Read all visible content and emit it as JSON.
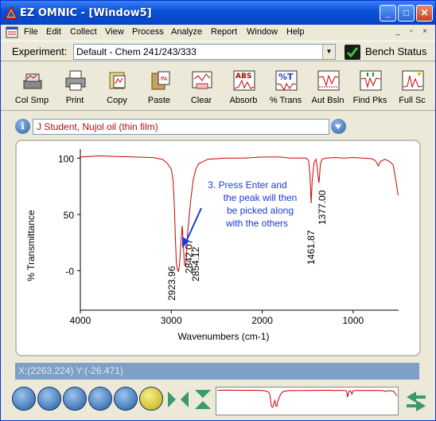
{
  "window": {
    "title": "EZ OMNIC - [Window5]",
    "minimize": "_",
    "maximize": "□",
    "close": "✕"
  },
  "menu": [
    "File",
    "Edit",
    "Collect",
    "View",
    "Process",
    "Analyze",
    "Report",
    "Window",
    "Help"
  ],
  "mdi": {
    "minimize": "_",
    "restore": "▫",
    "close": "×"
  },
  "experiment": {
    "label": "Experiment:",
    "value": "Default - Chem 241/243/333",
    "bench_label": "Bench Status"
  },
  "toolbar": [
    {
      "label": "Col Smp",
      "icon": "collect-sample-icon"
    },
    {
      "label": "Print",
      "icon": "printer-icon"
    },
    {
      "label": "Copy",
      "icon": "copy-icon"
    },
    {
      "label": "Paste",
      "icon": "paste-icon"
    },
    {
      "label": "Clear",
      "icon": "clear-icon"
    },
    {
      "label": "Absorb",
      "icon": "absorbance-icon"
    },
    {
      "label": "% Trans",
      "icon": "transmittance-icon"
    },
    {
      "label": "Aut Bsln",
      "icon": "auto-baseline-icon"
    },
    {
      "label": "Find Pks",
      "icon": "find-peaks-icon"
    },
    {
      "label": "Full Sc",
      "icon": "full-scale-icon"
    }
  ],
  "spectrum_title": "J Student, Nujol oil (thin film)",
  "status_text": "X:(2263.224) Y:(-26.471)",
  "bottom_tools": [
    "select-arrow-icon",
    "region-tool-icon",
    "peak-pick-icon",
    "peak-height-icon",
    "peak-area-icon",
    "annotation-text-icon",
    "expand-horizontal-icon",
    "expand-vertical-icon"
  ],
  "colors": {
    "spectrum": "#cc0000",
    "annotation": "#1a3ad8",
    "arrow": "#1a3ad8"
  },
  "chart_data": {
    "type": "line",
    "xlabel": "Wavenumbers (cm-1)",
    "ylabel": "% Transmittance",
    "xlim": [
      4000,
      500
    ],
    "ylim": [
      -35,
      108
    ],
    "xticks": [
      4000,
      3000,
      2000,
      1000
    ],
    "yticks": [
      100,
      50,
      0
    ],
    "ytick_labels": [
      "100",
      "50",
      "-0"
    ],
    "series": [
      {
        "x": [
          3999,
          3800,
          3600,
          3400,
          3200,
          3100,
          3050,
          3000,
          2980,
          2965,
          2955,
          2945,
          2935,
          2923.96,
          2910,
          2900,
          2880,
          2870,
          2860,
          2854.12,
          2842.07,
          2830,
          2820,
          2810,
          2790,
          2760,
          2730,
          2700,
          2600,
          2400,
          2200,
          2000,
          1800,
          1700,
          1600,
          1520,
          1490,
          1475,
          1461.87,
          1450,
          1430,
          1410,
          1395,
          1385,
          1377,
          1370,
          1360,
          1340,
          1300,
          1200,
          1100,
          1000,
          900,
          800,
          760,
          740,
          722,
          700,
          650,
          600,
          560,
          540,
          520,
          505
        ],
        "y": [
          101,
          102,
          101.5,
          101,
          100.5,
          99,
          96,
          90,
          80,
          55,
          30,
          8,
          2,
          -1,
          5,
          18,
          40,
          28,
          12,
          5,
          4,
          18,
          35,
          42,
          60,
          80,
          90,
          95,
          99,
          100,
          100,
          101,
          101,
          100,
          100,
          100,
          98,
          85,
          60,
          80,
          96,
          99,
          92,
          83,
          78,
          84,
          95,
          99,
          100,
          100.5,
          100,
          100.5,
          100,
          99.5,
          98,
          96,
          93,
          97,
          99,
          97,
          94,
          85,
          75,
          67
        ]
      }
    ],
    "peaks": [
      {
        "x": 2923.96,
        "label": "2923.96"
      },
      {
        "x": 2842.07,
        "label": "2842.07"
      },
      {
        "x": 2854.12,
        "label": "2854.12"
      },
      {
        "x": 1461.87,
        "label": "1461.87"
      },
      {
        "x": 1377.0,
        "label": "1377.00"
      }
    ],
    "annotation": [
      "3. Press Enter and",
      "the peak will then",
      "be picked along",
      "with the others"
    ]
  }
}
